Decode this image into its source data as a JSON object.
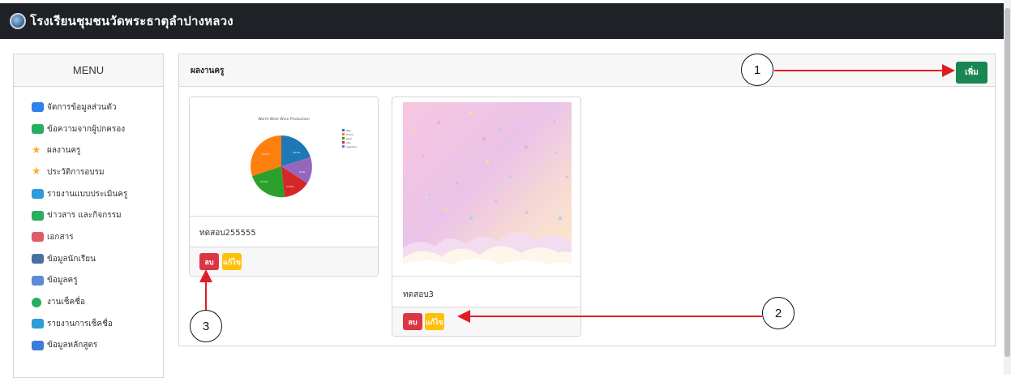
{
  "header": {
    "title": "โรงเรียนชุมชนวัดพระธาตุลำปางหลวง"
  },
  "menu": {
    "title": "MENU",
    "items": [
      {
        "label": "จัดการข้อมูลส่วนตัว",
        "icon": "id-card-icon",
        "color": "#2f80ed"
      },
      {
        "label": "ข้อความจากผู้ปกครอง",
        "icon": "message-icon",
        "color": "#27ae60"
      },
      {
        "label": "ผลงานครู",
        "icon": "star-icon",
        "color": "#f2b233"
      },
      {
        "label": "ประวัติการอบรม",
        "icon": "star-icon",
        "color": "#f2b233"
      },
      {
        "label": "รายงานแบบประเมินครู",
        "icon": "report-icon",
        "color": "#2d9cdb"
      },
      {
        "label": "ข่าวสาร และกิจกรรม",
        "icon": "message-icon",
        "color": "#27ae60"
      },
      {
        "label": "เอกสาร",
        "icon": "document-icon",
        "color": "#e05a6a"
      },
      {
        "label": "ข้อมูลนักเรียน",
        "icon": "student-icon",
        "color": "#4a6fa5"
      },
      {
        "label": "ข้อมูลครู",
        "icon": "teacher-icon",
        "color": "#5b8ad6"
      },
      {
        "label": "งานเช็คชื่อ",
        "icon": "check-icon",
        "color": "#27ae60"
      },
      {
        "label": "รายงานการเช็คชื่อ",
        "icon": "report-icon",
        "color": "#2d9cdb"
      },
      {
        "label": "ข้อมูลหลักสูตร",
        "icon": "curriculum-icon",
        "color": "#3b7dd8"
      }
    ]
  },
  "panel": {
    "title": "ผลงานครู",
    "add_label": "เพิ่ม",
    "cards": [
      {
        "name": "ทดสอบ255555",
        "delete_label": "ลบ",
        "edit_label": "แก้ไข"
      },
      {
        "name": "ทดสอบ3",
        "delete_label": "ลบ",
        "edit_label": "แก้ไข"
      }
    ]
  },
  "thumbnail_chart": {
    "title": "World Wide Wine Production",
    "legend": [
      "Italy",
      "France",
      "Spain",
      "USA",
      "Argentina"
    ],
    "colors": [
      "#1f77b4",
      "#ff7f0e",
      "#2ca02c",
      "#d62728",
      "#9467bd"
    ]
  },
  "annotations": [
    "1",
    "2",
    "3"
  ]
}
